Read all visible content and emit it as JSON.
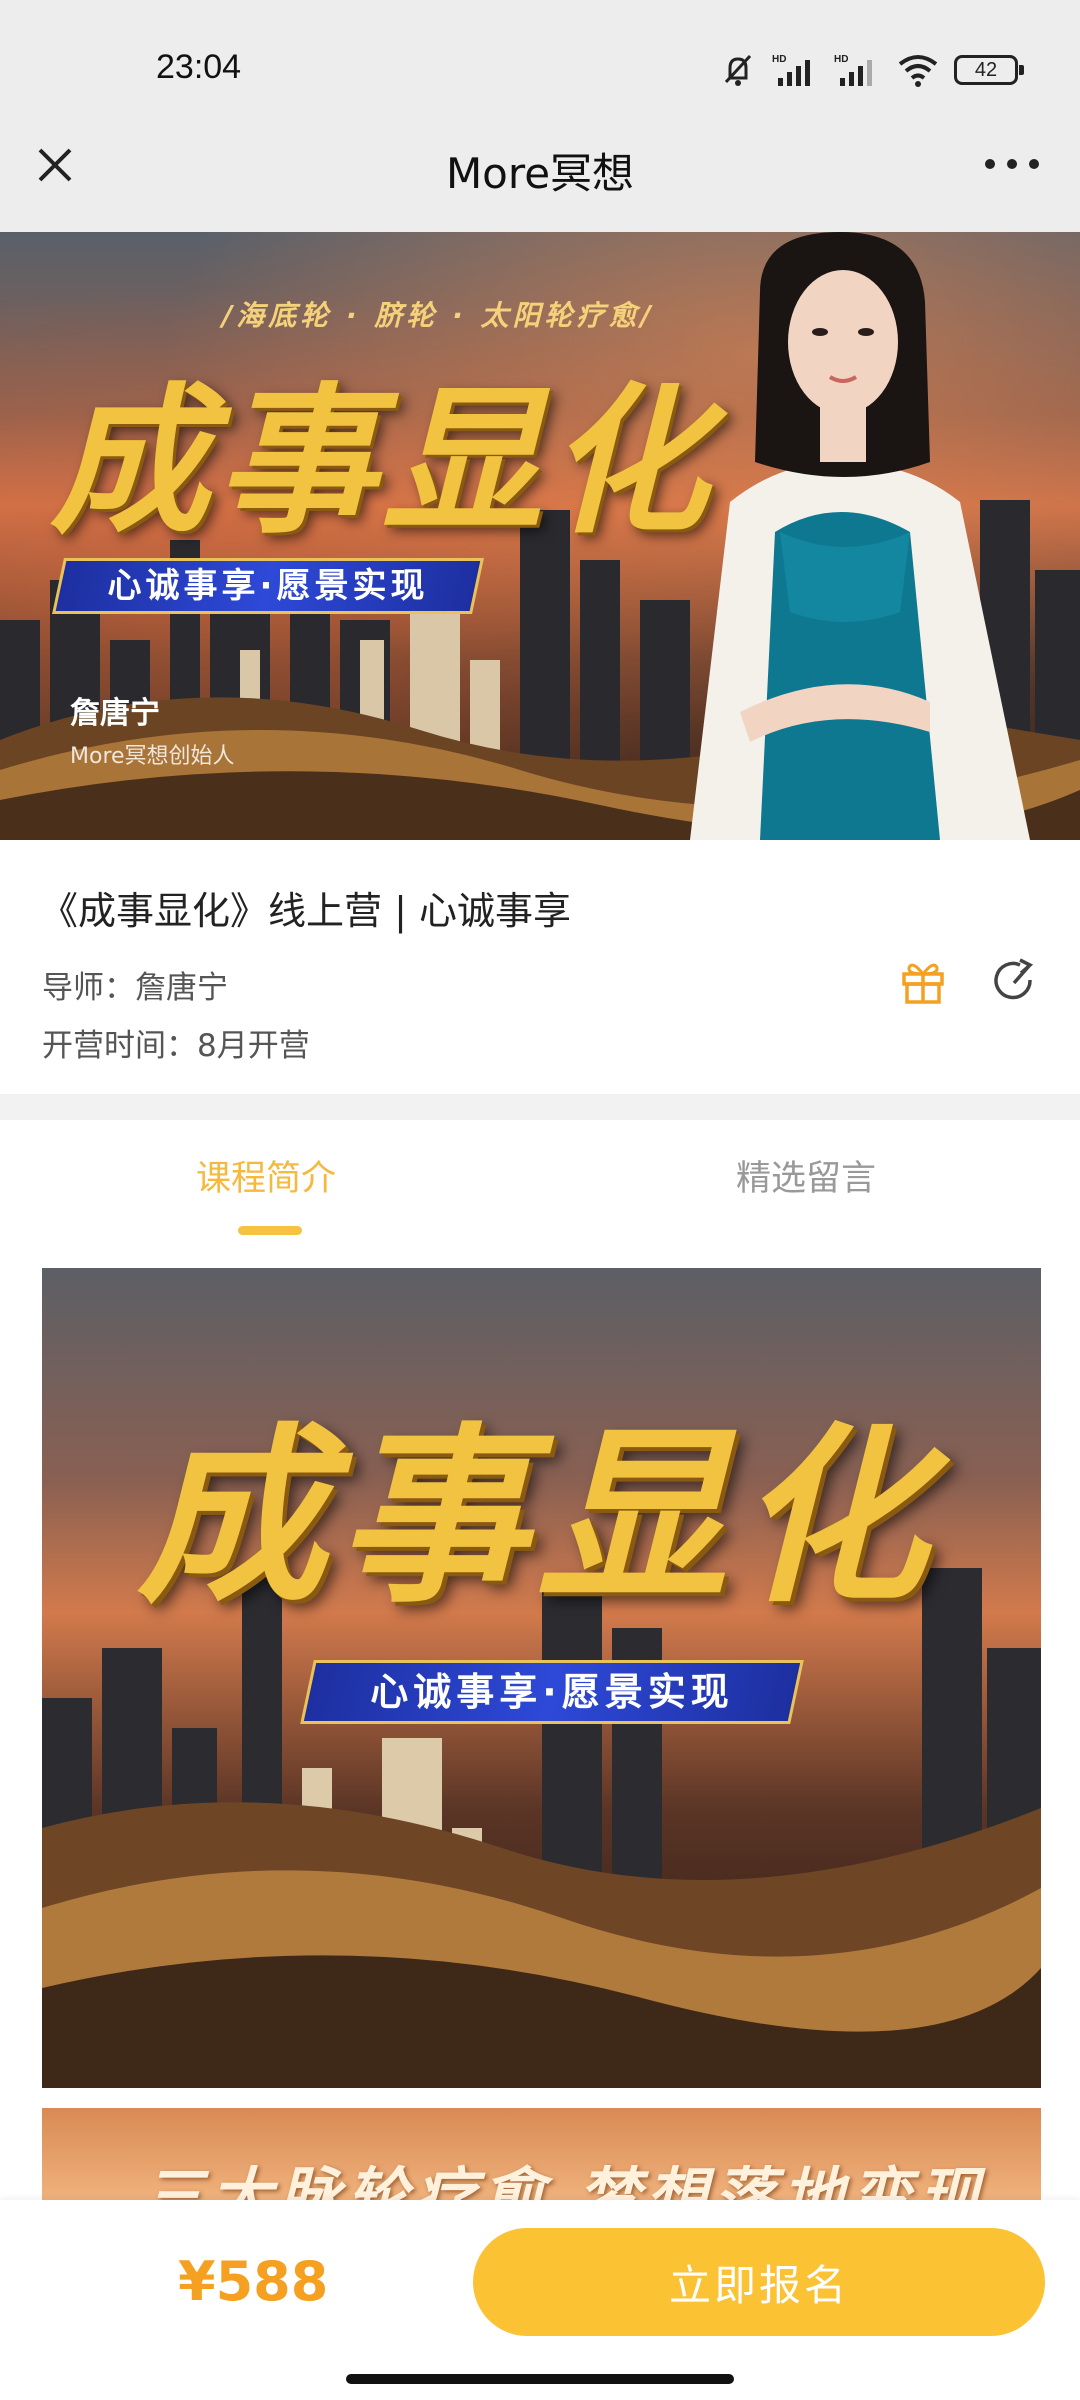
{
  "status_bar": {
    "time": "23:04",
    "battery": "42",
    "icons": [
      "mute-icon",
      "hd-signal-icon",
      "hd-signal-icon",
      "wifi-icon",
      "battery-icon"
    ]
  },
  "nav": {
    "title": "More冥想",
    "close_icon": "close-icon",
    "more_icon": "more-icon"
  },
  "hero": {
    "tagline": "/海底轮 · 脐轮 · 太阳轮疗愈/",
    "big_title": "成事显化",
    "ribbon": "心诚事享·愿景实现",
    "name": "詹唐宁",
    "role": "More冥想创始人"
  },
  "course": {
    "title": "《成事显化》线上营 | 心诚事享",
    "mentor": "导师：詹唐宁",
    "start_time": "开营时间：8月开营"
  },
  "tabs": [
    {
      "label": "课程简介",
      "active": true
    },
    {
      "label": "精选留言",
      "active": false
    }
  ],
  "content": {
    "image_title": "成事显化",
    "image_ribbon": "心诚事享·愿景实现",
    "second_image_text": "三大脉轮疗愈 梦想落地变现"
  },
  "bottom": {
    "price": "¥588",
    "signup_label": "立即报名"
  },
  "colors": {
    "accent": "#fbc234",
    "price": "#f5a020",
    "tab_active": "#f5b940"
  }
}
